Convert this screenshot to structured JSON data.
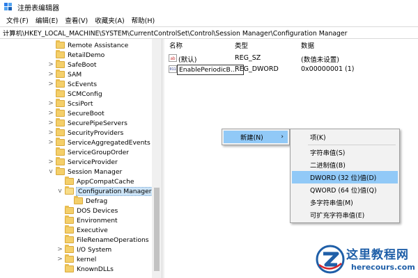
{
  "window": {
    "title": "注册表编辑器"
  },
  "menu": [
    "文件(F)",
    "编辑(E)",
    "查看(V)",
    "收藏夹(A)",
    "帮助(H)"
  ],
  "address": "计算机\\HKEY_LOCAL_MACHINE\\SYSTEM\\CurrentControlSet\\Control\\Session Manager\\Configuration Manager",
  "tree": [
    {
      "label": "Remote Assistance",
      "chevron": ""
    },
    {
      "label": "RetailDemo",
      "chevron": ""
    },
    {
      "label": "SafeBoot",
      "chevron": ">"
    },
    {
      "label": "SAM",
      "chevron": ">"
    },
    {
      "label": "ScEvents",
      "chevron": ">"
    },
    {
      "label": "SCMConfig",
      "chevron": ""
    },
    {
      "label": "ScsiPort",
      "chevron": ">"
    },
    {
      "label": "SecureBoot",
      "chevron": ">"
    },
    {
      "label": "SecurePipeServers",
      "chevron": ">"
    },
    {
      "label": "SecurityProviders",
      "chevron": ">"
    },
    {
      "label": "ServiceAggregatedEvents",
      "chevron": ">"
    },
    {
      "label": "ServiceGroupOrder",
      "chevron": ""
    },
    {
      "label": "ServiceProvider",
      "chevron": ">"
    },
    {
      "label": "Session Manager",
      "chevron": "v"
    },
    {
      "label": "AppCompatCache",
      "chevron": ""
    },
    {
      "label": "Configuration Manager",
      "chevron": "v"
    },
    {
      "label": "Defrag",
      "chevron": ""
    },
    {
      "label": "DOS Devices",
      "chevron": ""
    },
    {
      "label": "Environment",
      "chevron": ""
    },
    {
      "label": "Executive",
      "chevron": ""
    },
    {
      "label": "FileRenameOperations",
      "chevron": ""
    },
    {
      "label": "I/O System",
      "chevron": ">"
    },
    {
      "label": "kernel",
      "chevron": ">"
    },
    {
      "label": "KnownDLLs",
      "chevron": ""
    }
  ],
  "list": {
    "headers": [
      "名称",
      "类型",
      "数据"
    ],
    "rows": [
      {
        "name": "(默认)",
        "type": "REG_SZ",
        "data": "(数值未设置)",
        "icon": "ab"
      },
      {
        "name": "EnablePeriodicB...",
        "type": "REG_DWORD",
        "data": "0x00000001 (1)",
        "icon": "011"
      }
    ]
  },
  "context_menu": {
    "new_label": "新建(N)",
    "submenu": [
      "项(K)",
      "字符串值(S)",
      "二进制值(B)",
      "DWORD (32 位)值(D)",
      "QWORD (64 位)值(Q)",
      "多字符串值(M)",
      "可扩充字符串值(E)"
    ]
  },
  "watermark": {
    "text": "这里教程网",
    "url": "herecours.com"
  }
}
